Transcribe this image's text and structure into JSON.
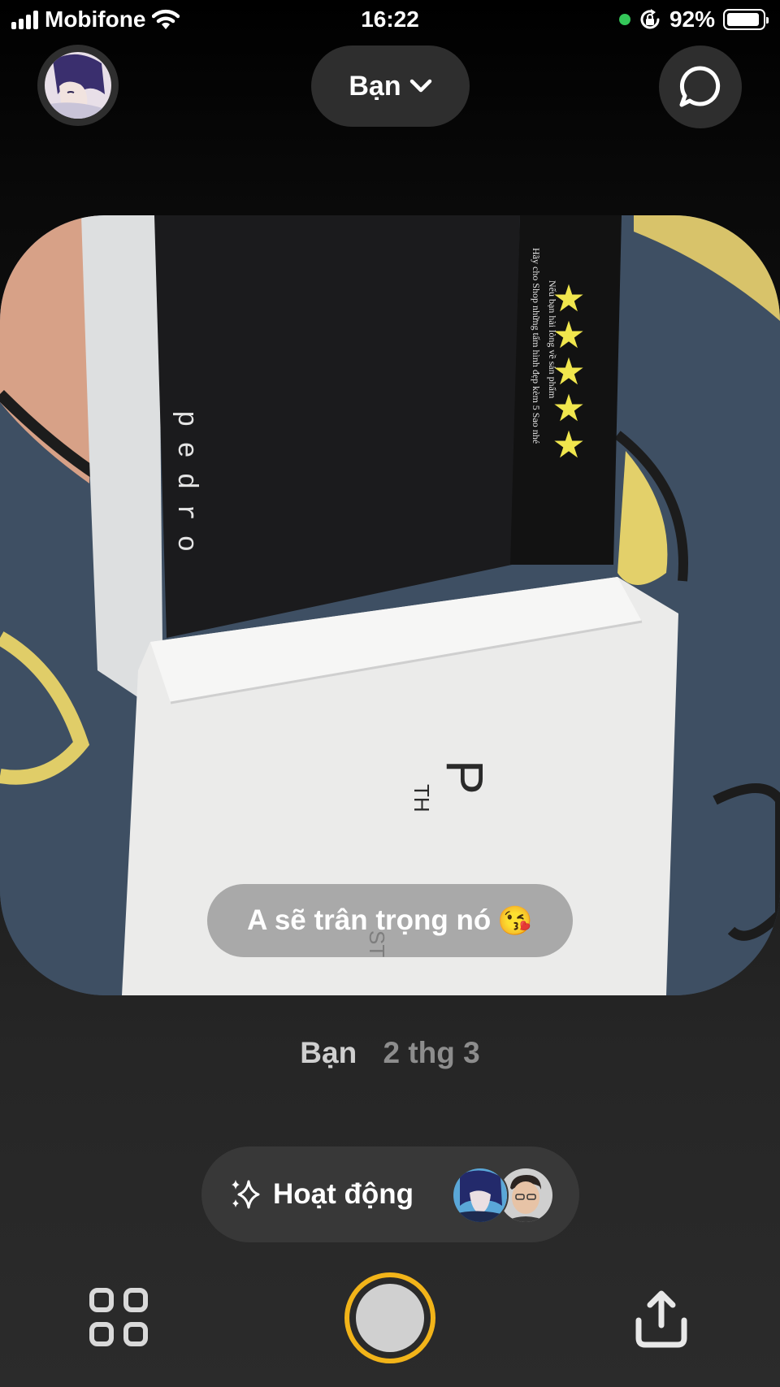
{
  "status_bar": {
    "carrier": "Mobifone",
    "time": "16:22",
    "battery": "92%",
    "battery_level": 0.92,
    "icons": [
      "signal-icon",
      "wifi-icon",
      "camera-in-use-dot",
      "rotation-lock-icon",
      "battery-icon"
    ]
  },
  "header": {
    "friends_filter_label": "Bạn",
    "left_button": "profile-avatar",
    "right_button": "chat-icon"
  },
  "post": {
    "caption_text": "A sẽ trân trọng nó",
    "caption_emoji": "😘",
    "author": "Bạn",
    "date": "2 thg 3",
    "photo_texts": {
      "brand_vertical": "pedro",
      "card_line_1": "Nếu bạn hài lòng về sản phẩm",
      "card_line_2": "Hãy cho Shop những tấm hình đẹp kèm 5 Sao nhé",
      "box_letter": "P",
      "box_partial_1": "TH",
      "box_partial_2": "ST"
    },
    "card_stars": 5
  },
  "activity": {
    "label": "Hoạt động",
    "icon": "sparkle-icon",
    "avatars": [
      "anime-avatar",
      "friend-avatar"
    ]
  },
  "bottom_bar": {
    "left": "grid-icon",
    "center": "shutter-button",
    "right": "share-icon",
    "accent_color": "#f2b419"
  }
}
